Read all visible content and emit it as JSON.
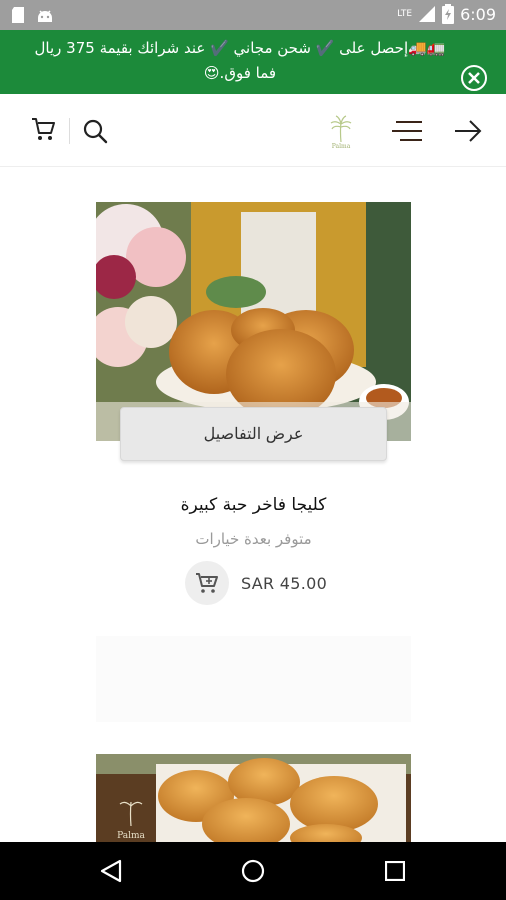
{
  "status_bar": {
    "time": "6:09",
    "network": "LTE",
    "icons": [
      "sd-card-icon",
      "android-icon",
      "signal-icon",
      "battery-icon"
    ]
  },
  "promo": {
    "text": "🚛🚚إحصل على ✔️ شحن مجاني ✔️ عند شرائك بقيمة 375 ريال فما فوق.😍",
    "background": "#1c8a3a"
  },
  "header": {
    "logo_text": "Palma",
    "icons": [
      "cart-icon",
      "search-icon",
      "menu-icon",
      "arrow-right-icon"
    ]
  },
  "product": {
    "details_label": "عرض التفاصيل",
    "title": "كليجا فاخر حبة كبيرة",
    "subtitle": "متوفر بعدة خيارات",
    "price": "SAR 45.00"
  },
  "product2": {
    "logo_text": "Palma"
  },
  "nav_bar": {
    "icons": [
      "back-icon",
      "home-icon",
      "recents-icon"
    ]
  }
}
